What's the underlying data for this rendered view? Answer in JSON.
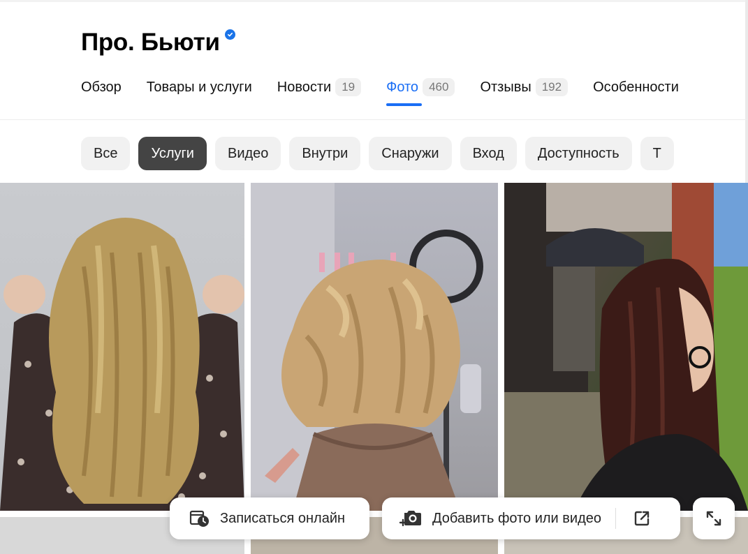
{
  "header": {
    "title": "Про. Бьюти",
    "verified": true
  },
  "tabs": [
    {
      "label": "Обзор"
    },
    {
      "label": "Товары и услуги"
    },
    {
      "label": "Новости",
      "count": "19"
    },
    {
      "label": "Фото",
      "count": "460",
      "active": true
    },
    {
      "label": "Отзывы",
      "count": "192"
    },
    {
      "label": "Особенности"
    }
  ],
  "filters": [
    {
      "label": "Все"
    },
    {
      "label": "Услуги",
      "active": true
    },
    {
      "label": "Видео"
    },
    {
      "label": "Внутри"
    },
    {
      "label": "Снаружи"
    },
    {
      "label": "Вход"
    },
    {
      "label": "Доступность"
    },
    {
      "label": "Т"
    }
  ],
  "actions": {
    "book_label": "Записаться онлайн",
    "add_label": "Добавить фото или видео",
    "book_icon": "calendar-clock-icon",
    "add_icon": "camera-plus-icon",
    "share_icon": "external-link-icon",
    "expand_icon": "expand-icon"
  },
  "colors": {
    "accent": "#1a6ef5",
    "active_chip": "#444444",
    "chip_bg": "#f1f1f1"
  }
}
